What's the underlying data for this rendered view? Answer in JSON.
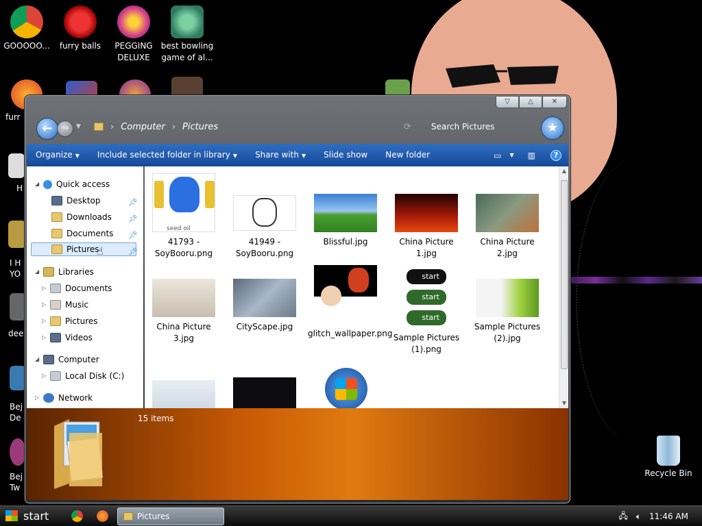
{
  "desktop": {
    "icons": [
      {
        "label": "GOOOOO...",
        "icon": "chrome-icon"
      },
      {
        "label": "furry balls",
        "icon": "furry-balls-icon"
      },
      {
        "label": "PEGGING DELUXE",
        "icon": "pegging-icon"
      },
      {
        "label": "best bowling game of al...",
        "icon": "bowling-icon"
      }
    ],
    "partial_labels": [
      "furr",
      "H",
      "I H YO",
      "deez",
      "Bej De",
      "Bej Tw"
    ],
    "recycle_bin": "Recycle Bin"
  },
  "window": {
    "address": {
      "crumbs": [
        "Computer",
        "Pictures"
      ]
    },
    "search_placeholder": "Search Pictures",
    "toolbar": {
      "organize": "Organize",
      "include": "Include selected folder in library",
      "share": "Share with",
      "slideshow": "Slide show",
      "newfolder": "New folder"
    },
    "nav": {
      "quick_access": "Quick access",
      "quick_items": [
        "Desktop",
        "Downloads",
        "Documents",
        "Pictures"
      ],
      "libraries": "Libraries",
      "library_items": [
        "Documents",
        "Music",
        "Pictures",
        "Videos"
      ],
      "computer": "Computer",
      "local_disk": "Local Disk (C:)",
      "network": "Network"
    },
    "files": [
      {
        "name": "41793 - SoyBooru.png"
      },
      {
        "name": "41949 - SoyBooru.png"
      },
      {
        "name": "Blissful.jpg"
      },
      {
        "name": "China Picture 1.jpg"
      },
      {
        "name": "China Picture 2.jpg"
      },
      {
        "name": "China Picture 3.jpg"
      },
      {
        "name": "CityScape.jpg"
      },
      {
        "name": "glitch_wallpaper.png"
      },
      {
        "name": "Sample Pictures (1).png"
      },
      {
        "name": "Sample Pictures (2).jpg"
      },
      {
        "name": ""
      },
      {
        "name": ""
      },
      {
        "name": ""
      }
    ],
    "thumb_texts": {
      "start": "start",
      "seed": "seed oil"
    },
    "details": {
      "count": "15 items"
    }
  },
  "taskbar": {
    "start": "start",
    "task_label": "Pictures",
    "clock": "11:46 AM"
  },
  "colors": {
    "toolbar": "#1f5bb0",
    "details_orange": "#e07a10",
    "selection": "#dcecfc"
  }
}
